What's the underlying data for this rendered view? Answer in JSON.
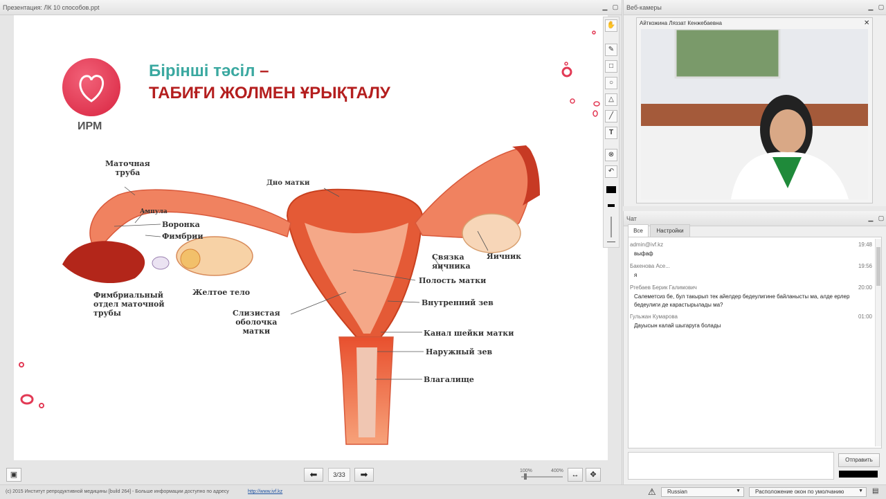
{
  "presentation": {
    "window_title": "Презентация: ЛК 10 способов.ppt",
    "slide": {
      "logo_text": "ИРМ",
      "title_line1_colored": "Бірінші тәсіл",
      "title_line1_dash": " –",
      "title_line2": "ТАБИҒИ ЖОЛМЕН ҰРЫҚТАЛУ",
      "labels": {
        "matochnaya_truba": "Маточная\nтруба",
        "ampula": "Ампула",
        "voronka": "Воронка",
        "fimbrii": "Фимбрии",
        "fimbrialny": "Фимбриальный\nотдел маточной\nтрубы",
        "zheltoe_telo": "Желтое тело",
        "dno_matki": "Дно матки",
        "slizistaya": "Слизистая\nоболочка\nматки",
        "svyazka": "Связка\nяичника",
        "yaichnik": "Яичник",
        "polost": "Полость матки",
        "vnutrenniy_zev": "Внутренний зев",
        "kanal": "Канал шейки матки",
        "naruzhny_zev": "Наружный зев",
        "vlagalische": "Влагалище"
      }
    },
    "page_indicator": "3/33",
    "zoom_min": "100%",
    "zoom_max": "400%"
  },
  "webcams": {
    "title": "Веб-камеры",
    "presenter_name": "Айткожина Ляззат Кенжебаевна"
  },
  "chat": {
    "title": "Чат",
    "tabs": [
      "Все",
      "Настройки"
    ],
    "messages": [
      {
        "author": "admin@ivf.kz",
        "time": "19:48",
        "text": "выфаф"
      },
      {
        "author": "Бакенова Асе...",
        "time": "19:56",
        "text": "я"
      },
      {
        "author": "Ргебаев Берик Галимович",
        "time": "20:00",
        "text": "Салеметсиз бе, бул такырып тек айелдер бедеулигине байланысты ма,  алде ерлер бедеулиги де карастырылады ма?"
      },
      {
        "author": "Гульжан Кумарова",
        "time": "01:00",
        "text": "Дауысын калай шыгаруга болады"
      }
    ],
    "send_label": "Отправить",
    "input_value": ""
  },
  "footer": {
    "copyright": "(c) 2015 Институт репродуктивной медицины [build 264] - Больше информации доступно по адресу",
    "link": "http://www.ivf.kz",
    "language": "Russian",
    "layout": "Расположение окон по умолчанию"
  },
  "colors": {
    "accent_teal": "#3aa8a0",
    "title_red": "#b41e1e",
    "brand_pink": "#e23a55"
  }
}
